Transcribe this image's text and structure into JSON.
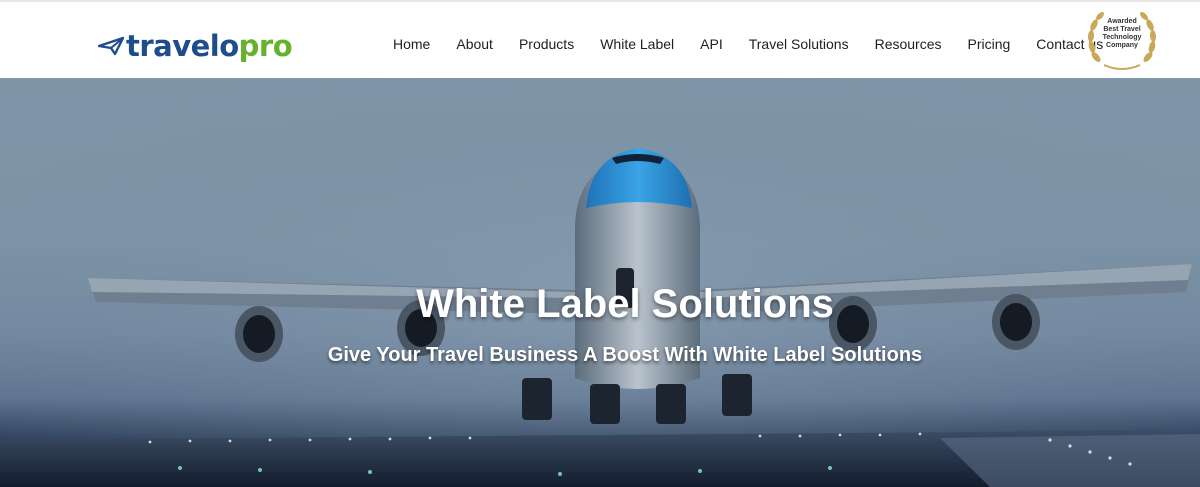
{
  "brand": {
    "logo_part1": "travelo",
    "logo_part2": "pro",
    "primary_color": "#1e4c8c",
    "accent_color": "#66b22f"
  },
  "nav": {
    "items": [
      {
        "label": "Home"
      },
      {
        "label": "About"
      },
      {
        "label": "Products"
      },
      {
        "label": "White Label"
      },
      {
        "label": "API"
      },
      {
        "label": "Travel Solutions"
      },
      {
        "label": "Resources"
      },
      {
        "label": "Pricing"
      },
      {
        "label": "Contact us"
      }
    ]
  },
  "award": {
    "line1": "Awarded",
    "line2": "Best Travel",
    "line3": "Technology",
    "line4": "Company",
    "color": "#c9a85a"
  },
  "hero": {
    "title": "White Label Solutions",
    "subtitle": "Give Your Travel Business A Boost With White Label Solutions"
  }
}
